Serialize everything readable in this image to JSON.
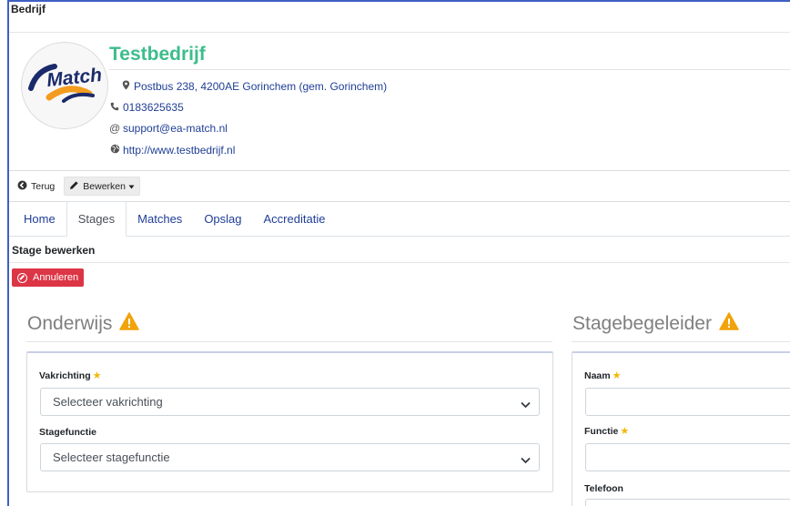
{
  "section": {
    "title": "Bedrijf"
  },
  "company": {
    "name": "Testbedrijf",
    "address": "Postbus 238, 4200AE Gorinchem (gem. Gorinchem)",
    "phone": "0183625635",
    "email": "support@ea-match.nl",
    "website": "http://www.testbedrijf.nl",
    "logo_text": "Match"
  },
  "toolbar": {
    "back_label": "Terug",
    "edit_label": "Bewerken"
  },
  "tabs": [
    {
      "label": "Home"
    },
    {
      "label": "Stages"
    },
    {
      "label": "Matches"
    },
    {
      "label": "Opslag"
    },
    {
      "label": "Accreditatie"
    }
  ],
  "active_tab": "Stages",
  "subheader": {
    "title": "Stage bewerken"
  },
  "actions": {
    "cancel_label": "Annuleren"
  },
  "onderwijs": {
    "title": "Onderwijs",
    "vakrichting": {
      "label": "Vakrichting",
      "value": "Selecteer vakrichting",
      "required": true
    },
    "stagefunctie": {
      "label": "Stagefunctie",
      "value": "Selecteer stagefunctie",
      "required": false
    }
  },
  "stagebegeleider": {
    "title": "Stagebegeleider",
    "naam": {
      "label": "Naam",
      "value": "",
      "required": true
    },
    "functie": {
      "label": "Functie",
      "value": "",
      "required": true
    },
    "telefoon": {
      "label": "Telefoon",
      "value": "",
      "required": false
    }
  },
  "colors": {
    "accent_green": "#3dbd8b",
    "link_blue": "#1f3e95",
    "danger": "#dc3545",
    "warning": "#f0a30a",
    "required_star": "#f2b705"
  },
  "icons": [
    "map-marker-icon",
    "phone-icon",
    "at-icon",
    "globe-icon",
    "back-circle-icon",
    "pencil-icon",
    "caret-down-icon",
    "ban-icon",
    "warning-triangle-icon",
    "star-icon",
    "chevron-down-icon"
  ]
}
